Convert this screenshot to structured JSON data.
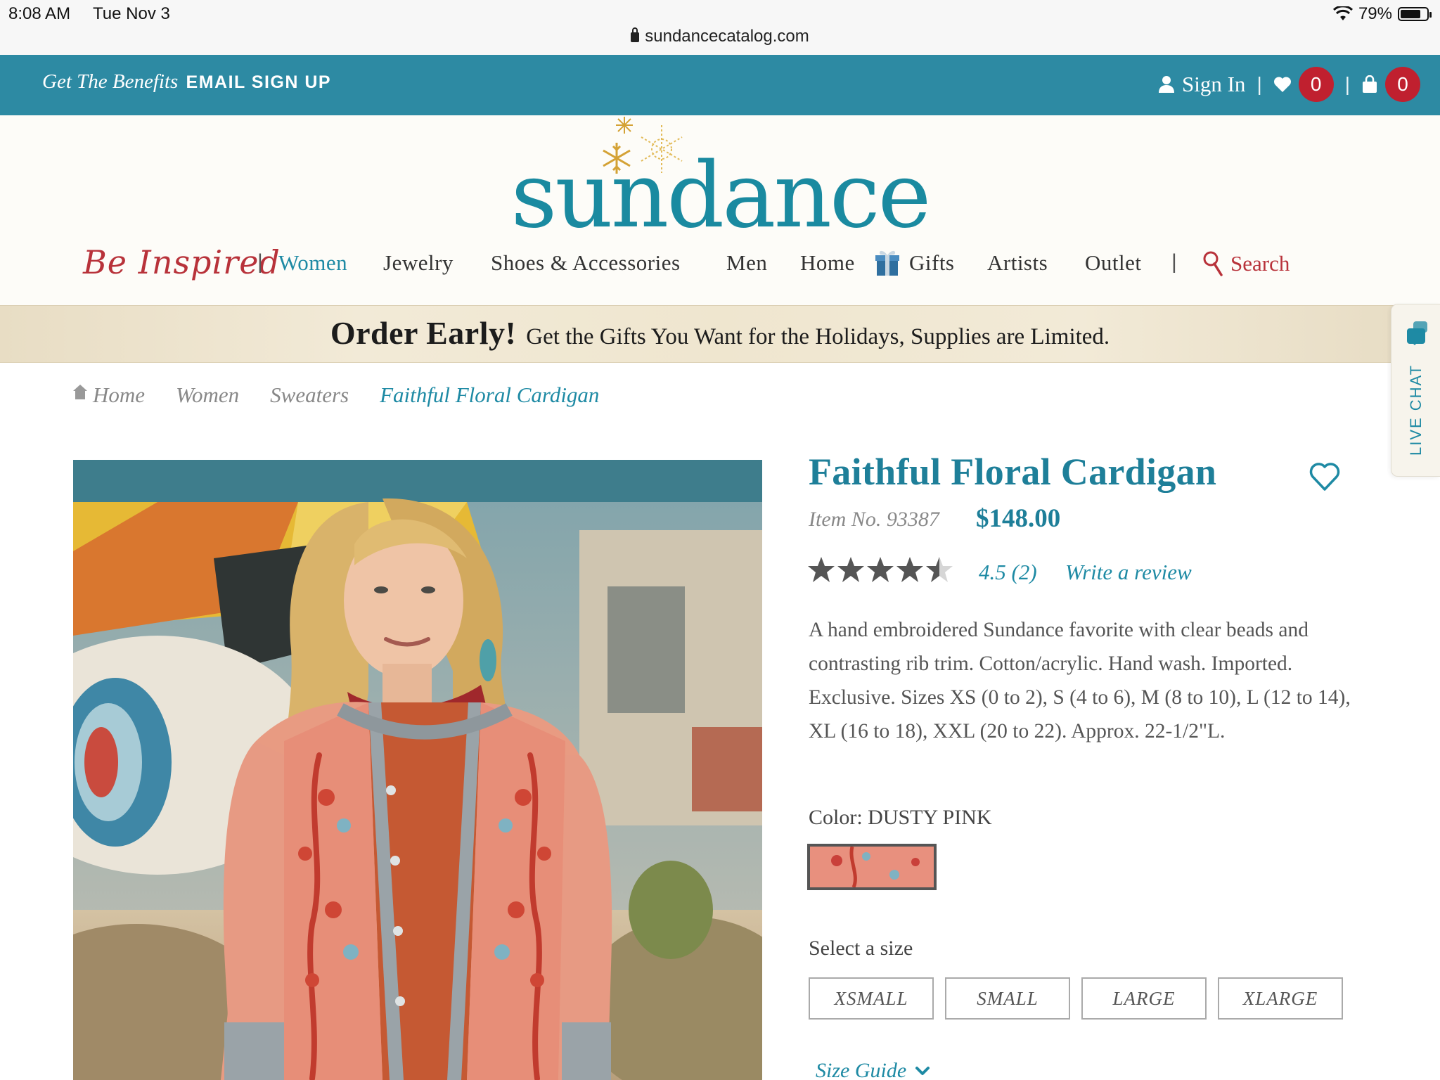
{
  "status_bar": {
    "time": "8:08 AM",
    "date": "Tue Nov 3",
    "battery": "79%",
    "battery_level": 0.79
  },
  "browser": {
    "url": "sundancecatalog.com"
  },
  "topbar": {
    "benefits_label": "Get The Benefits",
    "email_signup_label": "EMAIL SIGN UP",
    "signin_label": "Sign In",
    "wishlist_count": "0",
    "cart_count": "0"
  },
  "header": {
    "logo_text": "sundance"
  },
  "nav": {
    "inspired_label": "Be Inspired",
    "items": [
      "Women",
      "Jewelry",
      "Shoes & Accessories",
      "Men",
      "Home",
      "Gifts",
      "Artists",
      "Outlet"
    ],
    "active_item": "Women",
    "search_label": "Search"
  },
  "promo": {
    "headline": "Order Early!",
    "text": "Get the Gifts You Want for the Holidays, Supplies are Limited."
  },
  "live_chat": {
    "label": "LIVE CHAT"
  },
  "breadcrumb": [
    "Home",
    "Women",
    "Sweaters",
    "Faithful Floral Cardigan"
  ],
  "product": {
    "title": "Faithful Floral Cardigan",
    "item_no": "Item No. 93387",
    "price": "$148.00",
    "rating_value": 4.5,
    "rating_text": "4.5 (2)",
    "write_review_label": "Write a review",
    "description": "A hand embroidered Sundance favorite with clear beads and contrasting rib trim. Cotton/acrylic. Hand wash. Imported. Exclusive. Sizes XS (0 to 2), S (4 to 6), M (8 to 10), L (12 to 14), XL (16 to 18), XXL (20 to 22). Approx. 22-1/2\"L.",
    "color_label": "Color: DUSTY PINK",
    "size_label": "Select a size",
    "sizes": [
      "XSMALL",
      "SMALL",
      "LARGE",
      "XLARGE"
    ],
    "size_guide_label": "Size Guide"
  },
  "colors": {
    "teal_bar": "#2d8aa3",
    "brand_teal": "#1e8aa4",
    "accent_red": "#b8323a",
    "badge_red": "#c0202f"
  }
}
